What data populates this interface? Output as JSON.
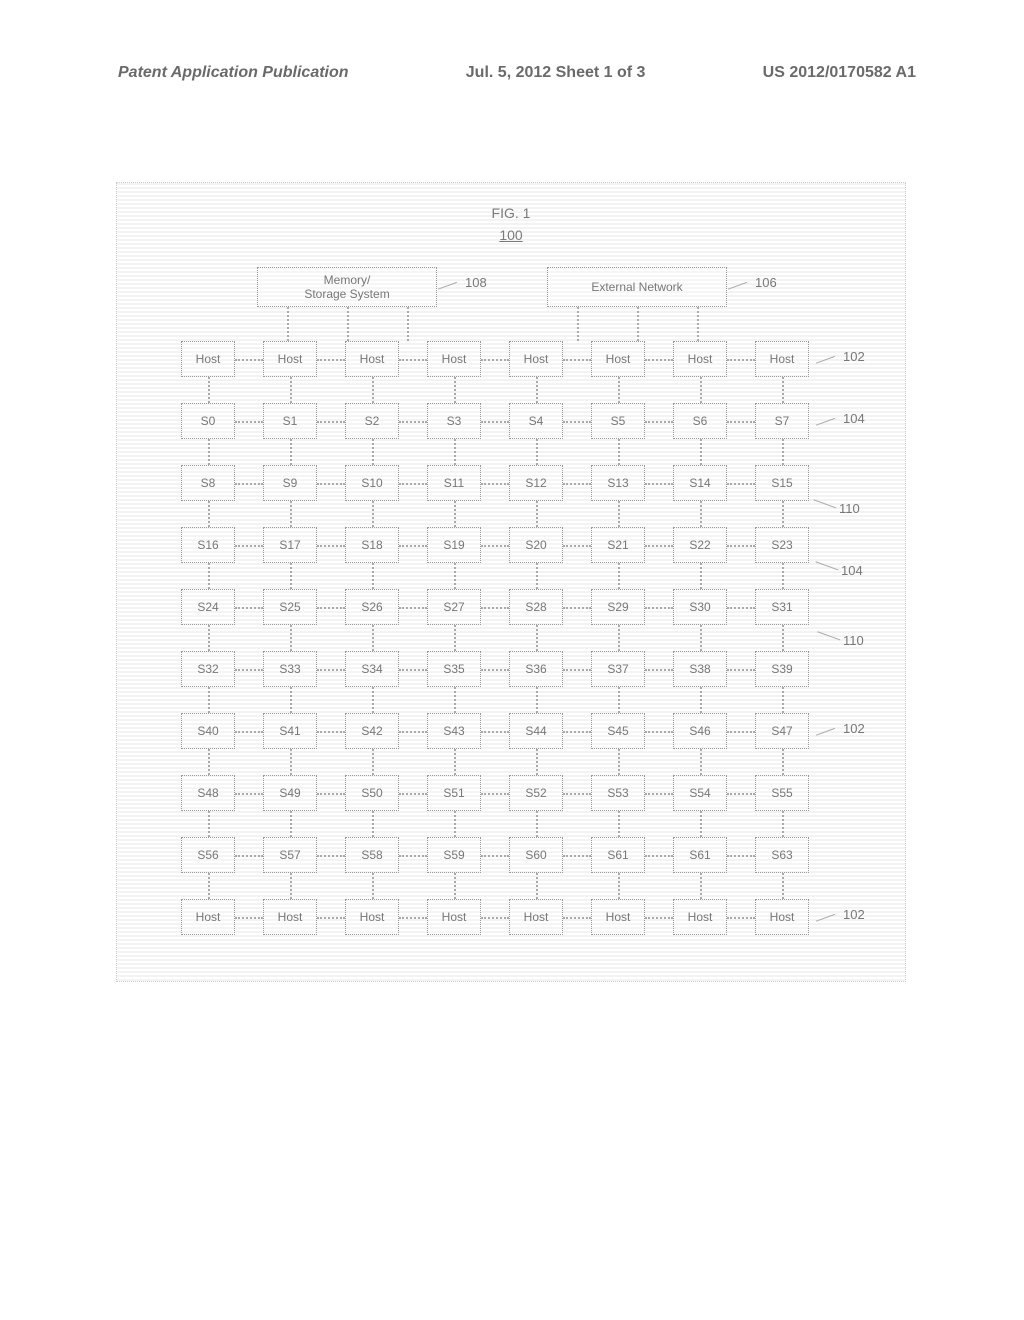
{
  "header": {
    "left": "Patent Application Publication",
    "center": "Jul. 5, 2012   Sheet 1 of 3",
    "right": "US 2012/0170582 A1"
  },
  "figure": {
    "title": "FIG. 1",
    "number": "100"
  },
  "top_blocks": {
    "memory": "Memory/\nStorage System",
    "external": "External Network"
  },
  "refs": {
    "r108": "108",
    "r106": "106",
    "r102a": "102",
    "r104a": "104",
    "r110a": "110",
    "r104b": "104",
    "r110b": "110",
    "r102b": "102",
    "r102c": "102"
  },
  "rows": [
    {
      "type": "host",
      "labels": [
        "Host",
        "Host",
        "Host",
        "Host",
        "Host",
        "Host",
        "Host",
        "Host"
      ]
    },
    {
      "type": "s",
      "labels": [
        "S0",
        "S1",
        "S2",
        "S3",
        "S4",
        "S5",
        "S6",
        "S7"
      ]
    },
    {
      "type": "s",
      "labels": [
        "S8",
        "S9",
        "S10",
        "S11",
        "S12",
        "S13",
        "S14",
        "S15"
      ]
    },
    {
      "type": "s",
      "labels": [
        "S16",
        "S17",
        "S18",
        "S19",
        "S20",
        "S21",
        "S22",
        "S23"
      ]
    },
    {
      "type": "s",
      "labels": [
        "S24",
        "S25",
        "S26",
        "S27",
        "S28",
        "S29",
        "S30",
        "S31"
      ]
    },
    {
      "type": "s",
      "labels": [
        "S32",
        "S33",
        "S34",
        "S35",
        "S36",
        "S37",
        "S38",
        "S39"
      ]
    },
    {
      "type": "s",
      "labels": [
        "S40",
        "S41",
        "S42",
        "S43",
        "S44",
        "S45",
        "S46",
        "S47"
      ]
    },
    {
      "type": "s",
      "labels": [
        "S48",
        "S49",
        "S50",
        "S51",
        "S52",
        "S53",
        "S54",
        "S55"
      ]
    },
    {
      "type": "s",
      "labels": [
        "S56",
        "S57",
        "S58",
        "S59",
        "S60",
        "S61",
        "S61",
        "S63"
      ]
    },
    {
      "type": "host",
      "labels": [
        "Host",
        "Host",
        "Host",
        "Host",
        "Host",
        "Host",
        "Host",
        "Host"
      ]
    }
  ],
  "chart_data": {
    "type": "diagram",
    "title": "FIG. 1",
    "figure_number": "100",
    "description": "8x8 switch mesh (S0-S63) with host rows top and bottom, connected to Memory/Storage System (108) and External Network (106)",
    "grid": {
      "columns": 8,
      "switch_rows": 8,
      "host_rows_top": 1,
      "host_rows_bottom": 1
    },
    "switch_labels": [
      "S0",
      "S1",
      "S2",
      "S3",
      "S4",
      "S5",
      "S6",
      "S7",
      "S8",
      "S9",
      "S10",
      "S11",
      "S12",
      "S13",
      "S14",
      "S15",
      "S16",
      "S17",
      "S18",
      "S19",
      "S20",
      "S21",
      "S22",
      "S23",
      "S24",
      "S25",
      "S26",
      "S27",
      "S28",
      "S29",
      "S30",
      "S31",
      "S32",
      "S33",
      "S34",
      "S35",
      "S36",
      "S37",
      "S38",
      "S39",
      "S40",
      "S41",
      "S42",
      "S43",
      "S44",
      "S45",
      "S46",
      "S47",
      "S48",
      "S49",
      "S50",
      "S51",
      "S52",
      "S53",
      "S54",
      "S55",
      "S56",
      "S57",
      "S58",
      "S59",
      "S60",
      "S61",
      "S61",
      "S63"
    ],
    "reference_numerals": {
      "102": "Host",
      "104": "Switch / switch row",
      "106": "External Network",
      "108": "Memory/Storage System",
      "110": "Inter-row link"
    }
  }
}
